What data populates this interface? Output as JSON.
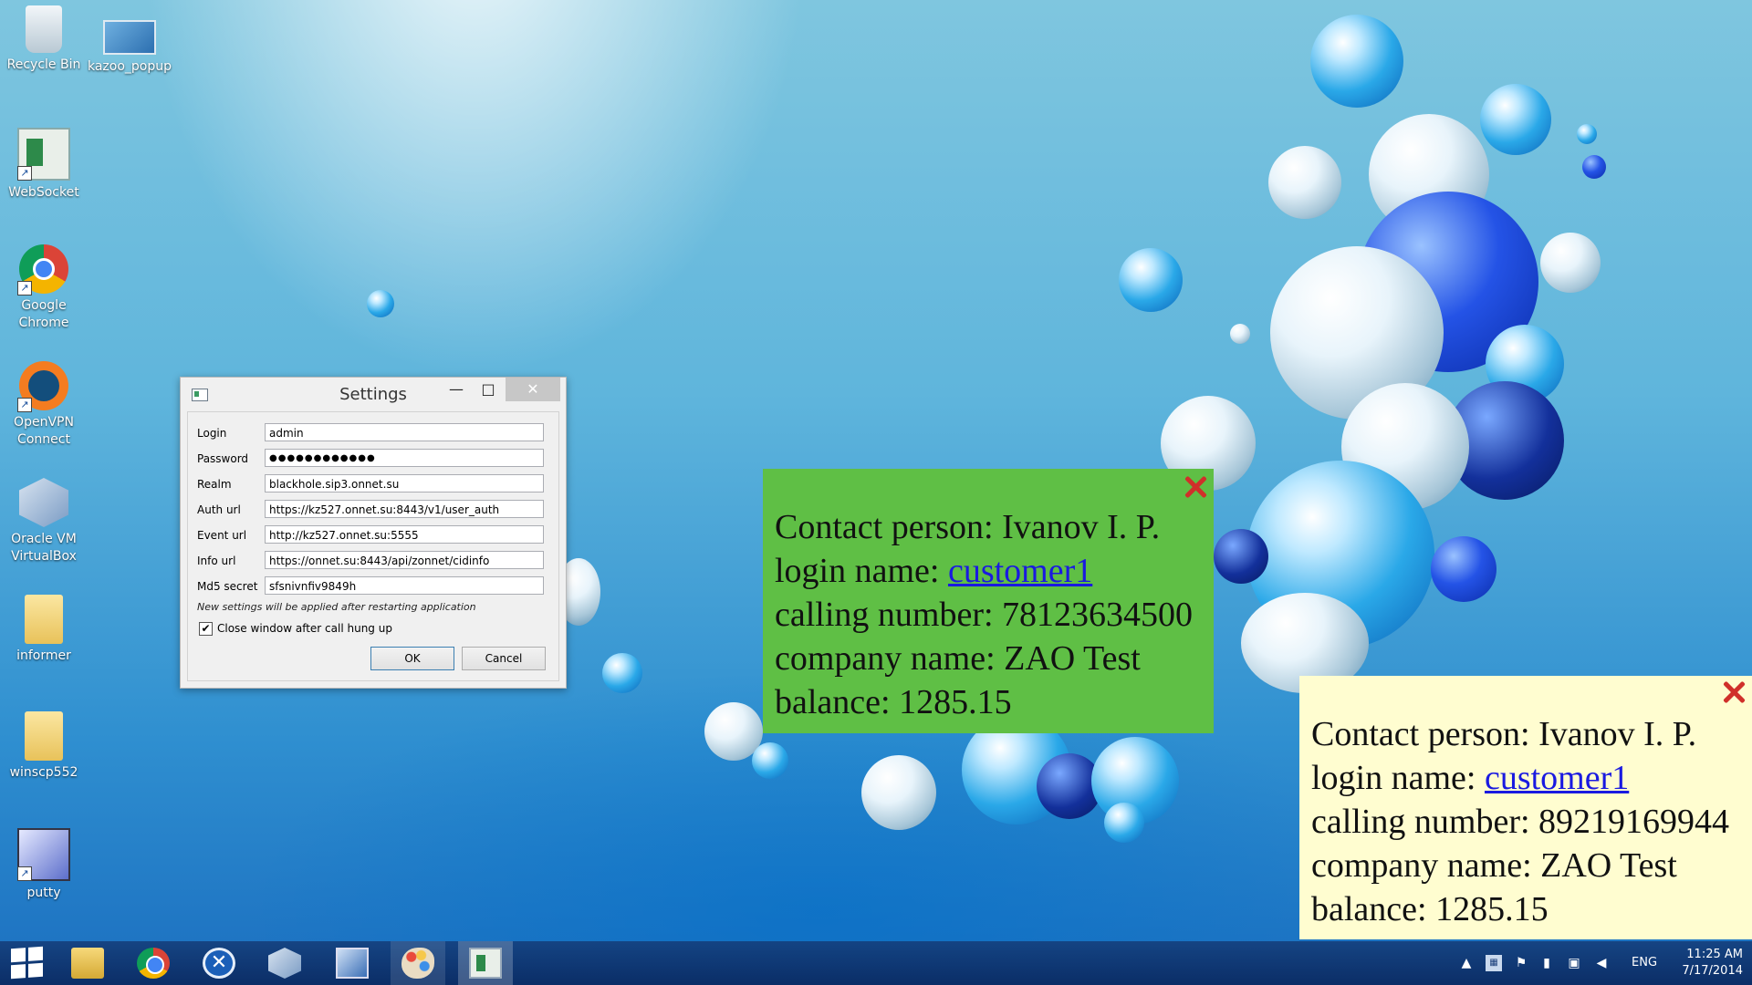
{
  "desktop": {
    "icons": [
      {
        "label": "Recycle Bin"
      },
      {
        "label": "kazoo_popup"
      },
      {
        "label": "WebSocket"
      },
      {
        "label": "Google Chrome"
      },
      {
        "label": "OpenVPN Connect"
      },
      {
        "label": "Oracle VM VirtualBox"
      },
      {
        "label": "informer"
      },
      {
        "label": "winscp552"
      },
      {
        "label": "putty"
      }
    ]
  },
  "settings_window": {
    "title": "Settings",
    "fields": [
      {
        "label": "Login",
        "value": "admin"
      },
      {
        "label": "Password",
        "value": "●●●●●●●●●●●●"
      },
      {
        "label": "Realm",
        "value": "blackhole.sip3.onnet.su"
      },
      {
        "label": "Auth url",
        "value": "https://kz527.onnet.su:8443/v1/user_auth"
      },
      {
        "label": "Event url",
        "value": "http://kz527.onnet.su:5555"
      },
      {
        "label": "Info url",
        "value": "https://onnet.su:8443/api/zonnet/cidinfo"
      },
      {
        "label": "Md5 secret",
        "value": "sfsnivnfiv9849h"
      }
    ],
    "note": "New settings will be applied after restarting application",
    "checkbox": {
      "label": "Close window after call hung up",
      "checked": true,
      "mark": "✔"
    },
    "ok_label": "OK",
    "cancel_label": "Cancel"
  },
  "popups": [
    {
      "background": "#5fbf45",
      "contact_label": "Contact person:",
      "contact": "Ivanov I. P.",
      "login_label": "login name:",
      "login": "customer1",
      "calling_label": "calling number:",
      "calling": "78123634500",
      "company_label": "company name:",
      "company": "ZAO Test",
      "balance_label": "balance:",
      "balance": "1285.15"
    },
    {
      "background": "#fffdd0",
      "contact_label": "Contact person:",
      "contact": "Ivanov I. P.",
      "login_label": "login name:",
      "login": "customer1",
      "calling_label": "calling number:",
      "calling": "89219169944",
      "company_label": "company name:",
      "company": "ZAO Test",
      "balance_label": "balance:",
      "balance": "1285.15"
    }
  ],
  "taskbar": {
    "items": [
      "start-icon",
      "file-explorer-icon",
      "chrome-icon",
      "x-app-icon",
      "virtualbox-icon",
      "network-app-icon",
      "paint-icon",
      "informer-app-icon"
    ],
    "tray": {
      "language": "ENG",
      "time": "11:25 AM",
      "date": "7/17/2014"
    }
  }
}
